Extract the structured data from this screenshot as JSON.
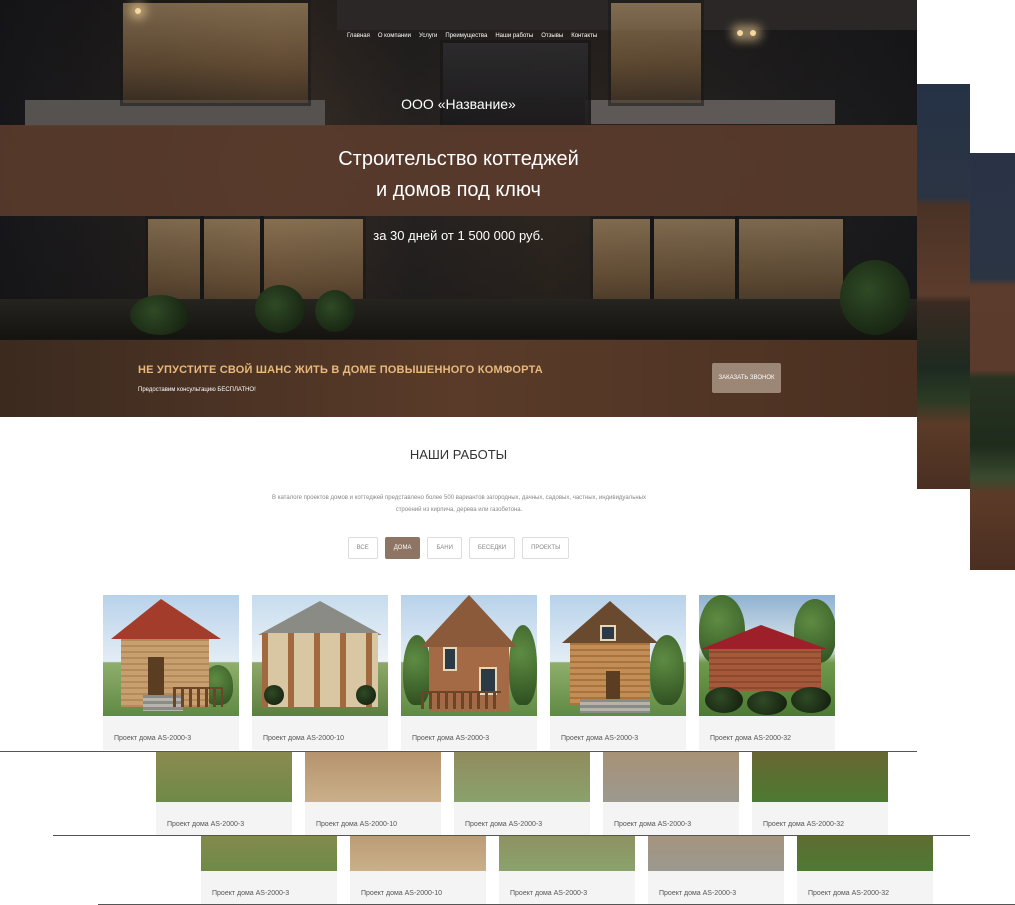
{
  "nav": {
    "items": [
      "Главная",
      "О компании",
      "Услуги",
      "Преимущества",
      "Наши работы",
      "Отзывы",
      "Контакты"
    ]
  },
  "hero": {
    "company": "ООО «Название»",
    "headline_line1": "Строительство коттеджей",
    "headline_line2": "и домов под ключ",
    "price": "за 30 дней от 1 500 000 руб."
  },
  "cta": {
    "title": "НЕ УПУСТИТЕ СВОЙ ШАНС ЖИТЬ В ДОМЕ ПОВЫШЕННОГО КОМФОРТА",
    "subtitle": "Предоставим консультацию БЕСПЛАТНО!",
    "button": "ЗАКАЗАТЬ ЗВОНОК"
  },
  "works": {
    "title": "НАШИ РАБОТЫ",
    "description": "В каталоге проектов домов и коттеджей представлено более 500 вариантов загородных, дачных, садовых, частных, индивидуальных строений из кирпича, дерева или газобетона.",
    "filters": [
      "ВСЕ",
      "ДОМА",
      "БАНИ",
      "БЕСЕДКИ",
      "ПРОЕКТЫ"
    ],
    "active_filter": "ДОМА",
    "cards": [
      {
        "label": "Проект дома AS-2000-3",
        "icon": "sauna-house-image"
      },
      {
        "label": "Проект дома AS-2000-10",
        "icon": "gazebo-image"
      },
      {
        "label": "Проект дома AS-2000-3",
        "icon": "brick-house-image"
      },
      {
        "label": "Проект дома AS-2000-3",
        "icon": "wooden-house-image"
      },
      {
        "label": "Проект дома AS-2000-32",
        "icon": "log-cabin-image"
      }
    ]
  },
  "colors": {
    "accent": "#8e7462",
    "cta_title": "#e8b97a",
    "band": "#5c3c2c"
  }
}
